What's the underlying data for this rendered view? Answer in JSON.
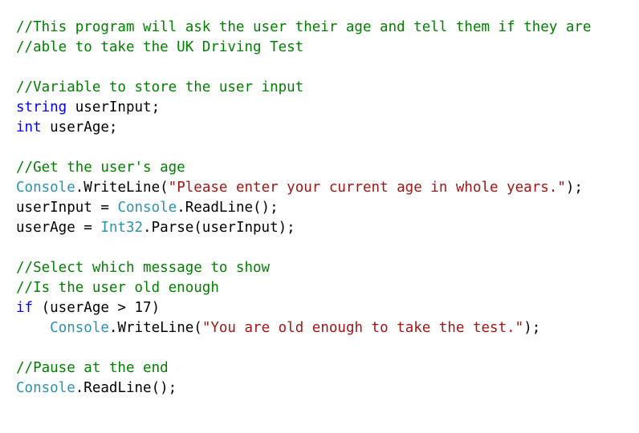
{
  "editor": {
    "language": "csharp",
    "background": "#ffffff",
    "colors": {
      "comment": "#008000",
      "keyword": "#0000ff",
      "type": "#2b91af",
      "string": "#a31515",
      "plain": "#000000"
    },
    "lines": [
      {
        "index": 1,
        "text": "//This program will ask the user their age and tell them if they are",
        "tokens": [
          {
            "kind": "comment",
            "text": "//This program will ask the user their age and tell them if they are"
          }
        ]
      },
      {
        "index": 2,
        "text": "//able to take the UK Driving Test",
        "tokens": [
          {
            "kind": "comment",
            "text": "//able to take the UK Driving Test"
          }
        ]
      },
      {
        "index": 3,
        "text": "",
        "tokens": []
      },
      {
        "index": 4,
        "text": "//Variable to store the user input",
        "tokens": [
          {
            "kind": "comment",
            "text": "//Variable to store the user input"
          }
        ]
      },
      {
        "index": 5,
        "text": "string userInput;",
        "tokens": [
          {
            "kind": "keyword",
            "text": "string"
          },
          {
            "kind": "plain",
            "text": " userInput;"
          }
        ]
      },
      {
        "index": 6,
        "text": "int userAge;",
        "tokens": [
          {
            "kind": "keyword",
            "text": "int"
          },
          {
            "kind": "plain",
            "text": " userAge;"
          }
        ]
      },
      {
        "index": 7,
        "text": "",
        "tokens": []
      },
      {
        "index": 8,
        "text": "//Get the user's age",
        "tokens": [
          {
            "kind": "comment",
            "text": "//Get the user's age"
          }
        ]
      },
      {
        "index": 9,
        "text": "Console.WriteLine(\"Please enter your current age in whole years.\");",
        "tokens": [
          {
            "kind": "type",
            "text": "Console"
          },
          {
            "kind": "plain",
            "text": ".WriteLine("
          },
          {
            "kind": "string",
            "text": "\"Please enter your current age in whole years.\""
          },
          {
            "kind": "plain",
            "text": ");"
          }
        ]
      },
      {
        "index": 10,
        "text": "userInput = Console.ReadLine();",
        "tokens": [
          {
            "kind": "plain",
            "text": "userInput = "
          },
          {
            "kind": "type",
            "text": "Console"
          },
          {
            "kind": "plain",
            "text": ".ReadLine();"
          }
        ]
      },
      {
        "index": 11,
        "text": "userAge = Int32.Parse(userInput);",
        "tokens": [
          {
            "kind": "plain",
            "text": "userAge = "
          },
          {
            "kind": "type",
            "text": "Int32"
          },
          {
            "kind": "plain",
            "text": ".Parse(userInput);"
          }
        ]
      },
      {
        "index": 12,
        "text": "",
        "tokens": []
      },
      {
        "index": 13,
        "text": "//Select which message to show",
        "tokens": [
          {
            "kind": "comment",
            "text": "//Select which message to show"
          }
        ]
      },
      {
        "index": 14,
        "text": "//Is the user old enough",
        "tokens": [
          {
            "kind": "comment",
            "text": "//Is the user old enough"
          }
        ]
      },
      {
        "index": 15,
        "text": "if (userAge > 17)",
        "tokens": [
          {
            "kind": "keyword",
            "text": "if"
          },
          {
            "kind": "plain",
            "text": " (userAge > 17)"
          }
        ]
      },
      {
        "index": 16,
        "text": "    Console.WriteLine(\"You are old enough to take the test.\");",
        "tokens": [
          {
            "kind": "plain",
            "text": "    "
          },
          {
            "kind": "type",
            "text": "Console"
          },
          {
            "kind": "plain",
            "text": ".WriteLine("
          },
          {
            "kind": "string",
            "text": "\"You are old enough to take the test.\""
          },
          {
            "kind": "plain",
            "text": ");"
          }
        ]
      },
      {
        "index": 17,
        "text": "",
        "tokens": []
      },
      {
        "index": 18,
        "text": "//Pause at the end",
        "tokens": [
          {
            "kind": "comment",
            "text": "//Pause at the end"
          }
        ]
      },
      {
        "index": 19,
        "text": "Console.ReadLine();",
        "tokens": [
          {
            "kind": "type",
            "text": "Console"
          },
          {
            "kind": "plain",
            "text": ".ReadLine();"
          }
        ]
      }
    ]
  }
}
